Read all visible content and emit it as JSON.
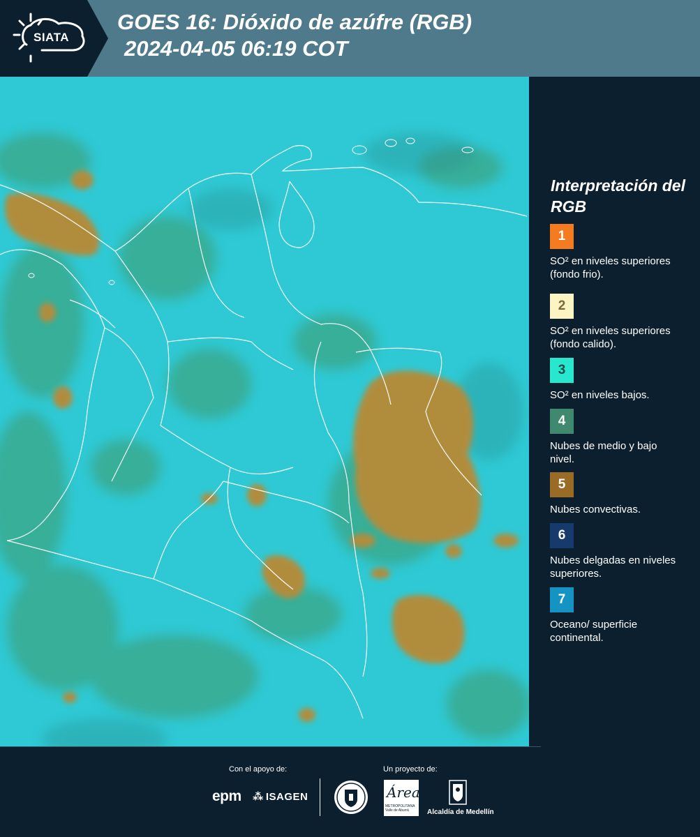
{
  "header": {
    "logo_text": "SIATA",
    "title": "GOES 16: Dióxido de azúfre (RGB)",
    "subtitle": "2024-04-05 06:19 COT",
    "background_color": "#4f7a8c",
    "logo_background_color": "#0c1f2e"
  },
  "legend": {
    "title": "Interpretación del RGB",
    "items": [
      {
        "number": "1",
        "description": "SO² en niveles superiores (fondo frio).",
        "color": "#f47b1f",
        "text_color": "#ffffff"
      },
      {
        "number": "2",
        "description": "SO² en niveles superiores (fondo calido).",
        "color": "#fdf4c4",
        "text_color": "#7a6a3a"
      },
      {
        "number": "3",
        "description": "SO² en niveles bajos.",
        "color": "#27e8cf",
        "text_color": "#1f4a44"
      },
      {
        "number": "4",
        "description": "Nubes de medio y bajo nivel.",
        "color": "#3f8a6e",
        "text_color": "#ffffff"
      },
      {
        "number": "5",
        "description": "Nubes convectivas.",
        "color": "#9a6b24",
        "text_color": "#ffffff"
      },
      {
        "number": "6",
        "description": "Nubes delgadas en niveles superiores.",
        "color": "#163a6b",
        "text_color": "#ffffff"
      },
      {
        "number": "7",
        "description": "Oceano/ superficie continental.",
        "color": "#1594c4",
        "text_color": "#ffffff"
      }
    ]
  },
  "map": {
    "background_color": "#2ec9d4",
    "green_cloud_color": "#3f9a6a",
    "convective_cloud_color": "#b08d3c",
    "border_color": "#ffffff"
  },
  "footer": {
    "support_label": "Con el apoyo de:",
    "project_label": "Un proyecto de:",
    "sponsor_logo_epm": "epm",
    "sponsor_logo_isagen": "ISAGEN",
    "area_logo_text": "Área",
    "area_logo_subtext": "METROPOLITANA Valle de Aburrá",
    "alcaldia_text": "Alcaldía de Medellín"
  }
}
